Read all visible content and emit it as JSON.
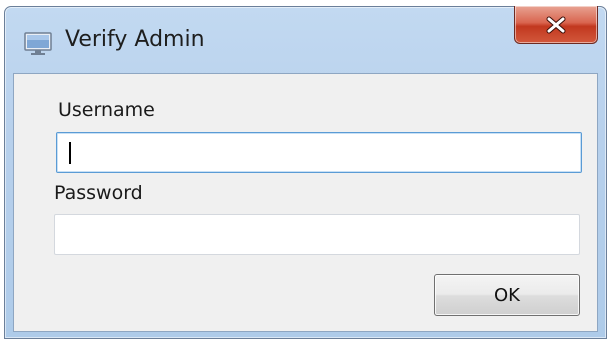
{
  "window": {
    "title": "Verify Admin",
    "icon": "window-app-icon",
    "close_icon": "close-x-icon",
    "accent": "#c2d9f1",
    "close_color": "#c2381f"
  },
  "form": {
    "username_label": "Username",
    "username_value": "",
    "password_label": "Password",
    "password_value": "",
    "ok_label": "OK"
  }
}
